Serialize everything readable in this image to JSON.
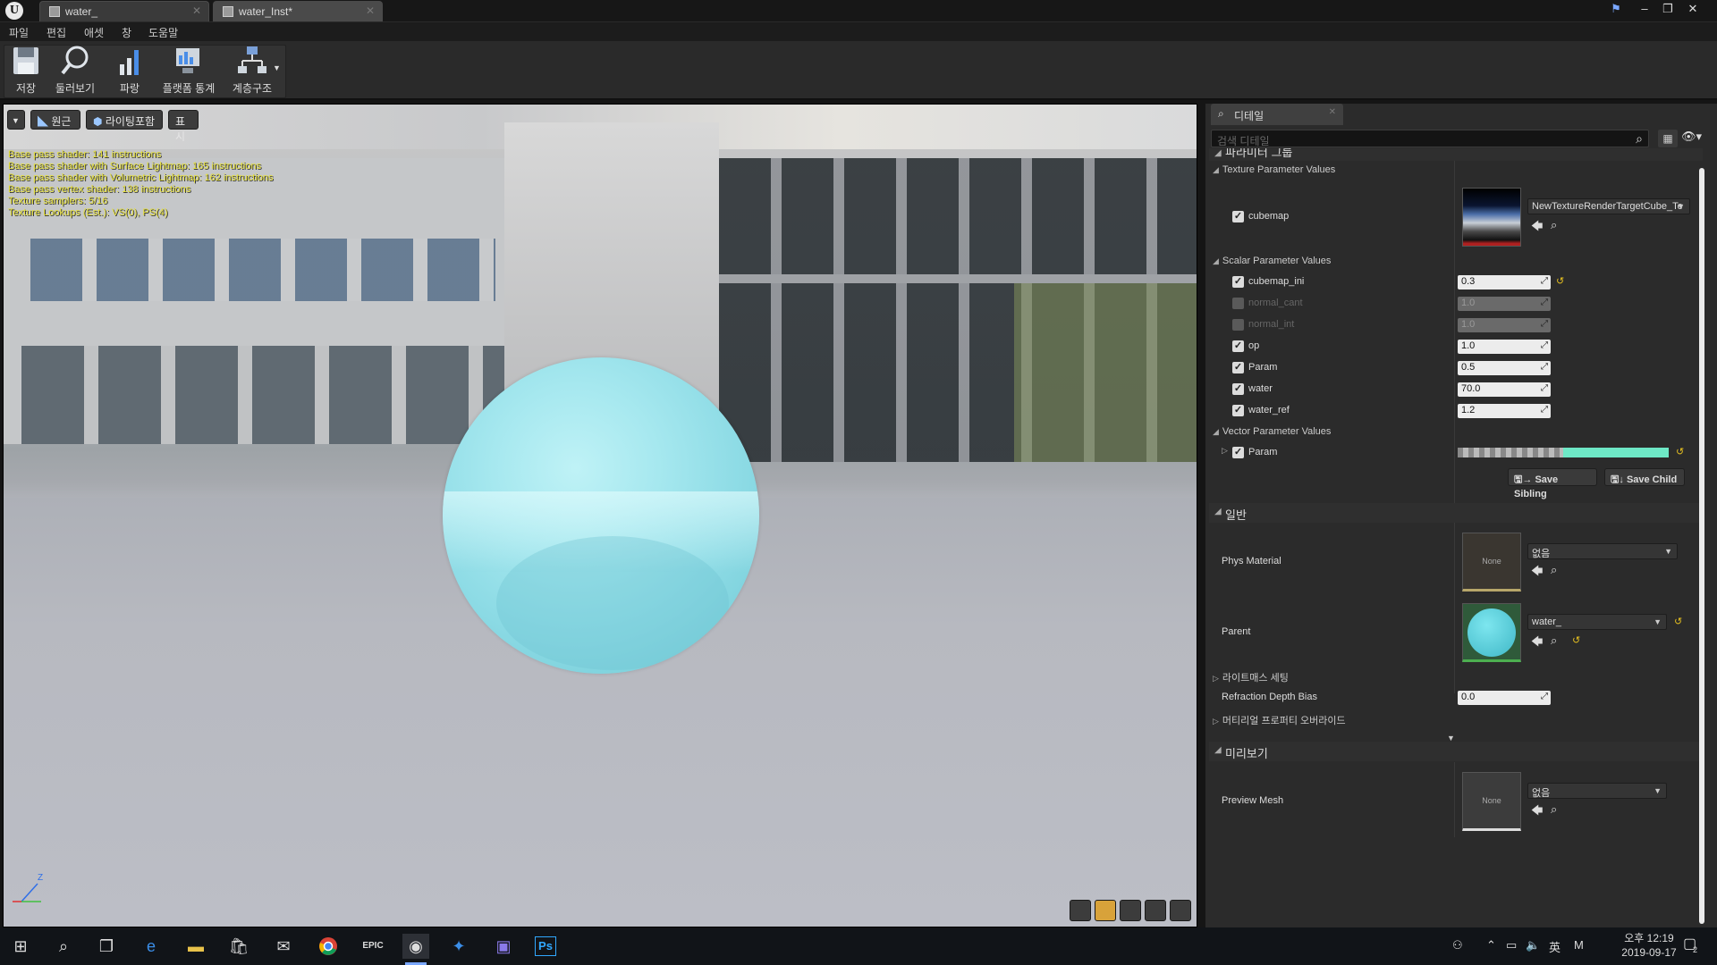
{
  "window": {
    "tabs": [
      {
        "label": "water_"
      },
      {
        "label": "water_Inst*"
      }
    ]
  },
  "menu": [
    "파일",
    "편집",
    "애셋",
    "창",
    "도움말"
  ],
  "toolbar": {
    "buttons": [
      {
        "label": "저장"
      },
      {
        "label": "둘러보기"
      },
      {
        "label": "파랑"
      },
      {
        "label": "플랫폼 통계"
      },
      {
        "label": "계층구조"
      }
    ]
  },
  "viewport": {
    "buttons": {
      "perspective": "원근",
      "lighting": "라이팅포함",
      "show": "표시"
    },
    "stats": [
      "Base pass shader: 141 instructions",
      "Base pass shader with Surface Lightmap: 165 instructions",
      "Base pass shader with Volumetric Lightmap: 162 instructions",
      "Base pass vertex shader: 138 instructions",
      "Texture samplers: 5/16",
      "Texture Lookups (Est.): VS(0), PS(4)"
    ],
    "axis": {
      "z": "Z",
      "x": "X",
      "y": "Y"
    }
  },
  "details": {
    "tab_label": "디테일",
    "search_placeholder": "검색 디테일",
    "param_group_title": "파라미터 그룹",
    "texture_group": "Texture Parameter Values",
    "texture_param": {
      "name": "cubemap",
      "checked": true,
      "asset": "NewTextureRenderTargetCube_Te"
    },
    "scalar_group": "Scalar Parameter Values",
    "scalar_params": [
      {
        "name": "cubemap_ini",
        "value": "0.3",
        "checked": true
      },
      {
        "name": "normal_cant",
        "value": "1.0",
        "checked": false
      },
      {
        "name": "normal_int",
        "value": "1.0",
        "checked": false
      },
      {
        "name": "op",
        "value": "1.0",
        "checked": true
      },
      {
        "name": "Param",
        "value": "0.5",
        "checked": true
      },
      {
        "name": "water",
        "value": "70.0",
        "checked": true
      },
      {
        "name": "water_ref",
        "value": "1.2",
        "checked": true
      }
    ],
    "vector_group": "Vector Parameter Values",
    "vector_param": {
      "name": "Param",
      "checked": true,
      "color": "#6ee8c6"
    },
    "save_sibling": "Save Sibling",
    "save_child": "Save Child",
    "general": {
      "title": "일반",
      "phys_material_label": "Phys Material",
      "phys_material_value": "없음",
      "phys_thumb": "None",
      "parent_label": "Parent",
      "parent_value": "water_",
      "lightmass": "라이트매스 세팅",
      "refraction_label": "Refraction Depth Bias",
      "refraction_value": "0.0",
      "overrides": "머티리얼 프로퍼티 오버라이드"
    },
    "preview": {
      "title": "미리보기",
      "mesh_label": "Preview Mesh",
      "mesh_value": "없음",
      "mesh_thumb": "None"
    }
  },
  "taskbar": {
    "epic": "EPIC",
    "ps": "Ps",
    "ime_lang": "英",
    "ime_mode": "M",
    "time": "오후 12:19",
    "date": "2019-09-17",
    "notifications": "2"
  }
}
